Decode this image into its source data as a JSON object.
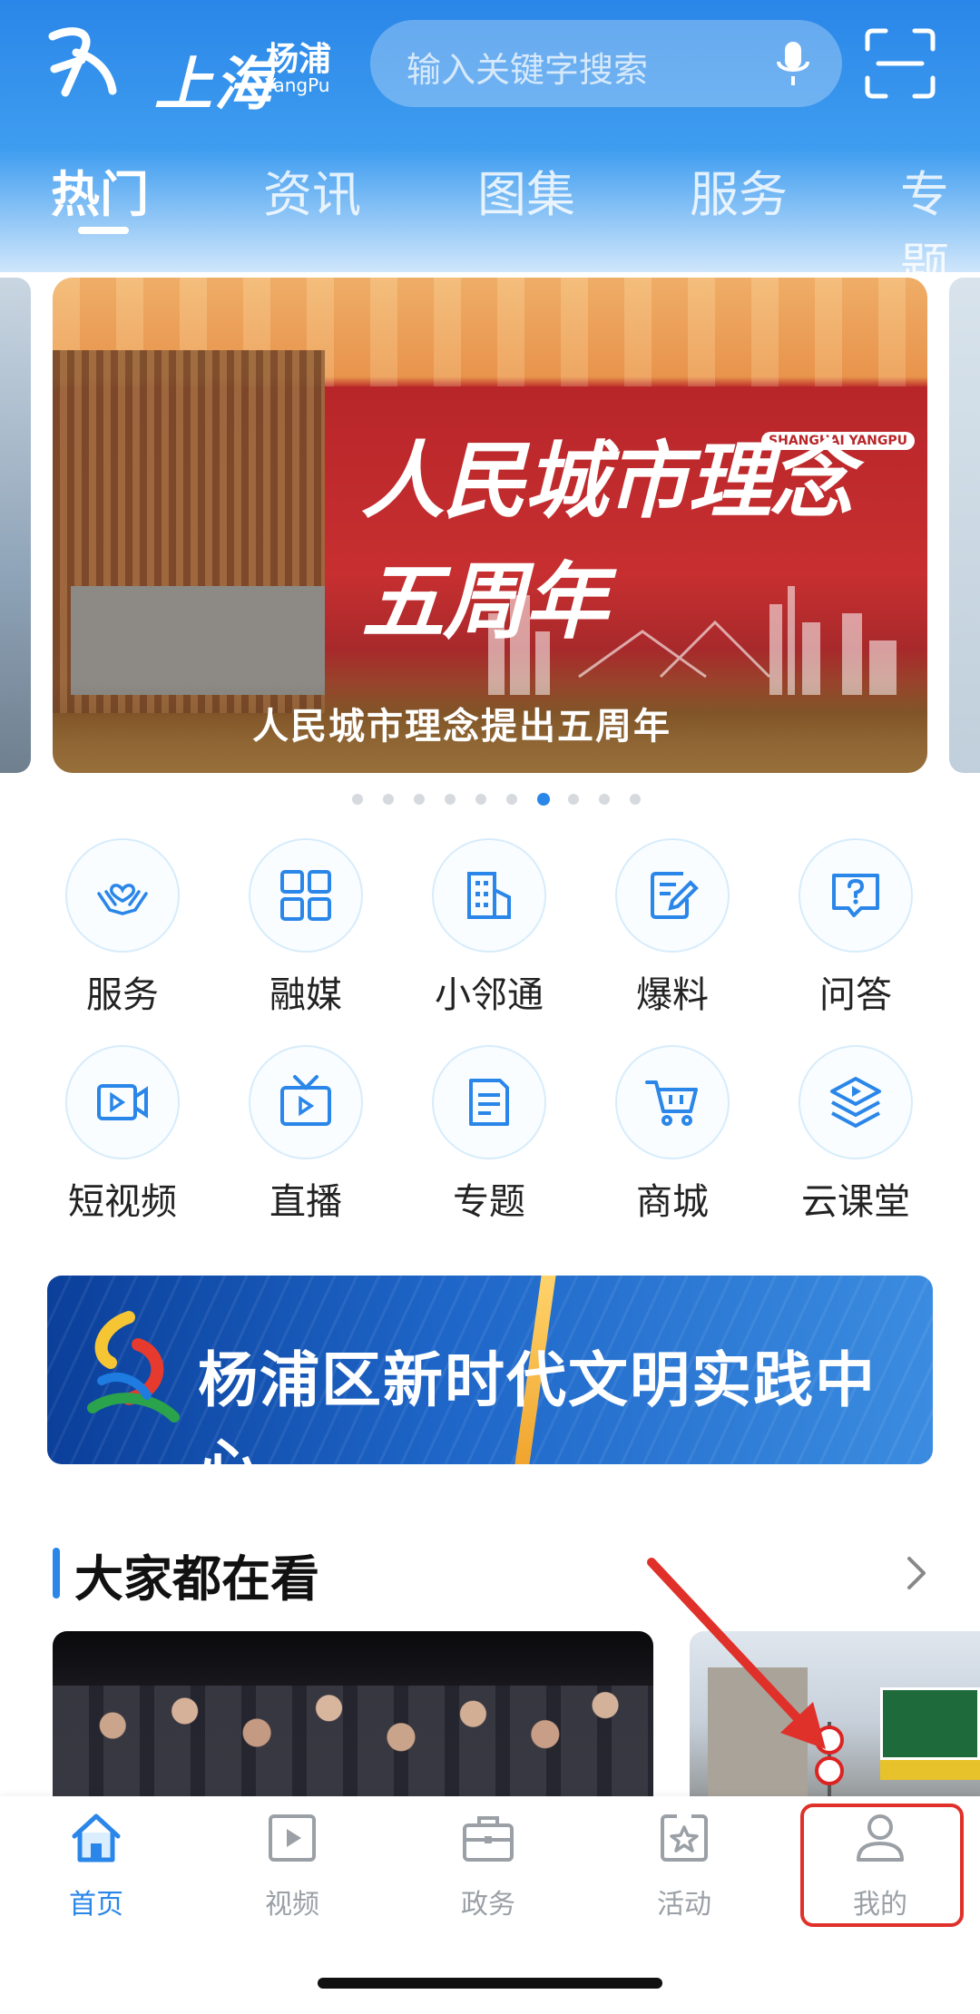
{
  "header": {
    "logo": {
      "main": "上海",
      "sub": "杨浦",
      "en": "YangPu"
    },
    "search": {
      "placeholder": "输入关键字搜索",
      "mic_icon": "mic-icon"
    },
    "scan_icon": "scan-icon",
    "tabs": [
      {
        "label": "热门",
        "active": true
      },
      {
        "label": "资讯"
      },
      {
        "label": "图集"
      },
      {
        "label": "服务"
      },
      {
        "label": "专题"
      }
    ]
  },
  "banner": {
    "headline": "人民城市理念五周年",
    "tag": "SHANGHAI YANGPU",
    "caption": "人民城市理念提出五周年",
    "page_count": 10,
    "active_index": 6
  },
  "grid": [
    {
      "label": "服务",
      "icon": "hands-heart-icon"
    },
    {
      "label": "融媒",
      "icon": "grid-icon"
    },
    {
      "label": "小邻通",
      "icon": "building-icon"
    },
    {
      "label": "爆料",
      "icon": "edit-note-icon"
    },
    {
      "label": "问答",
      "icon": "question-icon"
    },
    {
      "label": "短视频",
      "icon": "video-camera-icon"
    },
    {
      "label": "直播",
      "icon": "tv-play-icon"
    },
    {
      "label": "专题",
      "icon": "document-icon"
    },
    {
      "label": "商城",
      "icon": "cart-icon"
    },
    {
      "label": "云课堂",
      "icon": "layers-play-icon"
    }
  ],
  "promo": {
    "text": "杨浦区新时代文明实践中心"
  },
  "section": {
    "title": "大家都在看"
  },
  "bottom_nav": [
    {
      "label": "首页",
      "icon": "home-icon",
      "active": true
    },
    {
      "label": "视频",
      "icon": "play-square-icon"
    },
    {
      "label": "政务",
      "icon": "briefcase-icon"
    },
    {
      "label": "活动",
      "icon": "star-badge-icon"
    },
    {
      "label": "我的",
      "icon": "user-icon"
    }
  ],
  "colors": {
    "brand": "#2a86e8",
    "highlight": "#e0302a",
    "icon": "#2a86e8"
  }
}
